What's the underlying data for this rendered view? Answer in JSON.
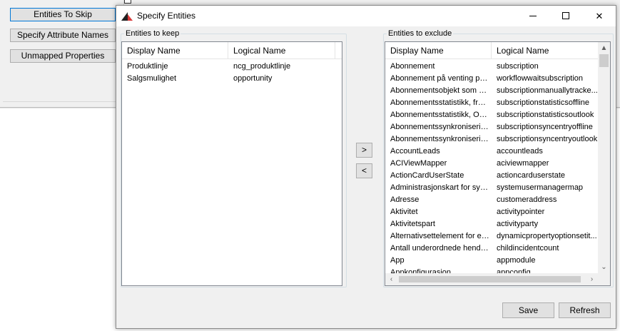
{
  "background_app": {
    "buttons": [
      "Entities To Skip",
      "Specify Attribute Names",
      "Unmapped Properties"
    ]
  },
  "dialog": {
    "title": "Specify Entities",
    "window_controls": {
      "minimize_icon": "minimize-icon",
      "maximize_icon": "maximize-icon",
      "close_label": "✕"
    },
    "keep": {
      "legend": "Entities to keep",
      "columns": [
        "Display Name",
        "Logical Name"
      ],
      "rows": [
        {
          "display": "Produktlinje",
          "logical": "ncg_produktlinje"
        },
        {
          "display": "Salgsmulighet",
          "logical": "opportunity"
        }
      ]
    },
    "exclude": {
      "legend": "Entities to exclude",
      "columns": [
        "Display Name",
        "Logical Name"
      ],
      "rows": [
        {
          "display": "Abonnement",
          "logical": "subscription"
        },
        {
          "display": "Abonnement på venting på ...",
          "logical": "workflowwaitsubscription"
        },
        {
          "display": "Abonnementsobjekt som sp...",
          "logical": "subscriptionmanuallytracke..."
        },
        {
          "display": "Abonnementsstatistikk, frak...",
          "logical": "subscriptionstatisticsoffline"
        },
        {
          "display": "Abonnementsstatistikk, Outl...",
          "logical": "subscriptionstatisticsoutlook"
        },
        {
          "display": "Abonnementssynkronisering...",
          "logical": "subscriptionsyncentryoffline"
        },
        {
          "display": "Abonnementssynkronisering...",
          "logical": "subscriptionsyncentryoutlook"
        },
        {
          "display": "AccountLeads",
          "logical": "accountleads"
        },
        {
          "display": "ACIViewMapper",
          "logical": "aciviewmapper"
        },
        {
          "display": "ActionCardUserState",
          "logical": "actioncarduserstate"
        },
        {
          "display": "Administrasjonskart for syste...",
          "logical": "systemusermanagermap"
        },
        {
          "display": "Adresse",
          "logical": "customeraddress"
        },
        {
          "display": "Aktivitet",
          "logical": "activitypointer"
        },
        {
          "display": "Aktivitetspart",
          "logical": "activityparty"
        },
        {
          "display": "Alternativsettelement for eg...",
          "logical": "dynamicpropertyoptionsetit..."
        },
        {
          "display": "Antall underordnede hendel...",
          "logical": "childincidentcount"
        },
        {
          "display": "App",
          "logical": "appmodule"
        },
        {
          "display": "Appkonfigurasjon",
          "logical": "appconfig"
        }
      ]
    },
    "move_right_label": ">",
    "move_left_label": "<",
    "save_label": "Save",
    "refresh_label": "Refresh",
    "scroll_up_glyph": "▲",
    "scroll_down_glyph": "⌄",
    "scroll_left_glyph": "‹",
    "scroll_right_glyph": "›"
  }
}
